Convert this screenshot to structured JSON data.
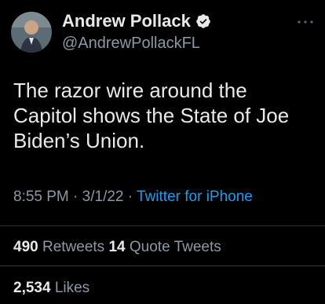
{
  "author": {
    "display_name": "Andrew Pollack",
    "handle": "@AndrewPollackFL",
    "verified_icon": "verified-badge-icon"
  },
  "tweet": {
    "text": "The razor wire around the Capitol shows the State of Joe Biden’s Union."
  },
  "meta": {
    "time": "8:55 PM",
    "date": "3/1/22",
    "source": "Twitter for iPhone"
  },
  "stats": {
    "retweets_count": "490",
    "retweets_label": "Retweets",
    "quote_count": "14",
    "quote_label": "Quote Tweets",
    "likes_count": "2,534",
    "likes_label": "Likes"
  },
  "colors": {
    "background": "#000000",
    "text": "#e7e9ea",
    "muted": "#8b98a5",
    "accent": "#1d9bf0",
    "divider": "#2f3336"
  }
}
